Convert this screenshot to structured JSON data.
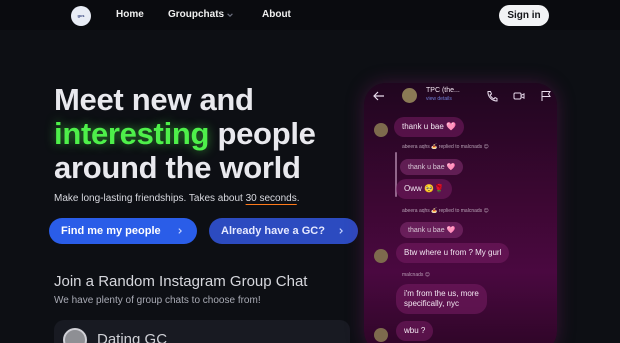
{
  "nav": {
    "logo_text": "gcs",
    "home": "Home",
    "groupchats": "Groupchats",
    "about": "About",
    "signin": "Sign in"
  },
  "hero": {
    "line1": "Meet new and",
    "highlight": "interesting",
    "line2_rest": " people",
    "line3": "around the world",
    "subtitle_pre": "Make long-lasting friendships. Takes about ",
    "subtitle_underlined": "30 seconds",
    "subtitle_post": ".",
    "btn_find": "Find me my people",
    "btn_gc": "Already have a GC?"
  },
  "join": {
    "title": "Join a Random Instagram Group Chat",
    "subtitle": "We have plenty of group chats to choose from!",
    "card_title": "Dating GC"
  },
  "phone": {
    "chat_name": "TPC (the...",
    "chat_sub": "view details",
    "messages": {
      "m1": "thank u bae 🩷",
      "reply1_note": "abeera aqhs 🍝 replied to malcnads 😊",
      "reply1_bubble": "thank u bae 🩷",
      "m2": "Oww 🥺🌹",
      "reply2_note": "abeera aqhs 🍝 replied to malcnads 😊",
      "reply2_bubble": "thank u bae 🩷",
      "m3": "Btw where u from ? My gurl",
      "sender_note": "malcnads 😊",
      "m4a": "i'm from the us, more",
      "m4b": "specifically, nyc",
      "m5": "wbu ?"
    }
  },
  "colors": {
    "background": "#0d0f14",
    "accent_green": "#4ef04a",
    "button_blue": "#2a5de8",
    "underline_orange": "#ff7a1a"
  }
}
